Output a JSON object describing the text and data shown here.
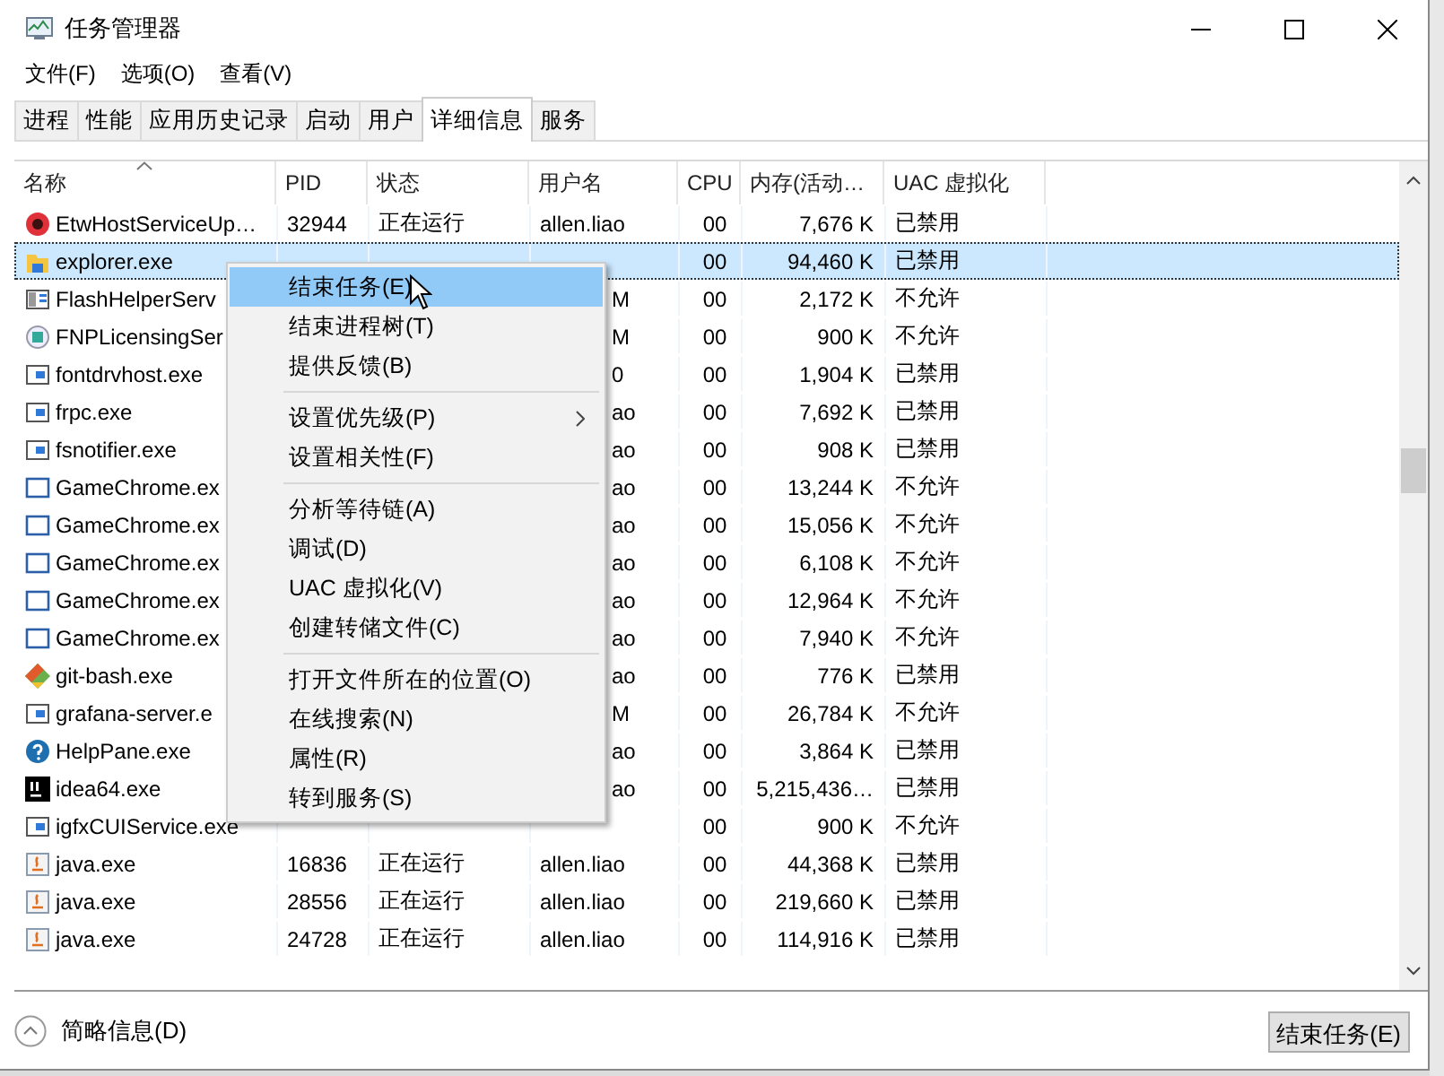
{
  "window": {
    "title": "任务管理器"
  },
  "menu_bar": [
    "文件(F)",
    "选项(O)",
    "查看(V)"
  ],
  "tabs": [
    {
      "label": "进程",
      "selected": false
    },
    {
      "label": "性能",
      "selected": false
    },
    {
      "label": "应用历史记录",
      "selected": false
    },
    {
      "label": "启动",
      "selected": false
    },
    {
      "label": "用户",
      "selected": false
    },
    {
      "label": "详细信息",
      "selected": true
    },
    {
      "label": "服务",
      "selected": false
    }
  ],
  "table": {
    "columns": [
      "名称",
      "PID",
      "状态",
      "用户名",
      "CPU",
      "内存(活动…",
      "UAC 虚拟化"
    ],
    "rows": [
      {
        "name": "EtwHostServiceUp…",
        "pid": "32944",
        "status": "正在运行",
        "user": "allen.liao",
        "cpu": "00",
        "memory": "7,676 K",
        "uac": "已禁用",
        "selected": false
      },
      {
        "name": "explorer.exe",
        "cpu": "00",
        "memory": "94,460 K",
        "uac": "已禁用",
        "selected": true
      },
      {
        "name": "FlashHelperServ",
        "user": "M",
        "cpu": "00",
        "memory": "2,172 K",
        "uac": "不允许",
        "selected": false
      },
      {
        "name": "FNPLicensingSer",
        "user": "M",
        "cpu": "00",
        "memory": "900 K",
        "uac": "不允许",
        "selected": false
      },
      {
        "name": "fontdrvhost.exe",
        "user": "0",
        "cpu": "00",
        "memory": "1,904 K",
        "uac": "已禁用",
        "selected": false
      },
      {
        "name": "frpc.exe",
        "user": "ao",
        "cpu": "00",
        "memory": "7,692 K",
        "uac": "已禁用",
        "selected": false
      },
      {
        "name": "fsnotifier.exe",
        "user": "ao",
        "cpu": "00",
        "memory": "908 K",
        "uac": "已禁用",
        "selected": false
      },
      {
        "name": "GameChrome.ex",
        "user": "ao",
        "cpu": "00",
        "memory": "13,244 K",
        "uac": "不允许",
        "selected": false
      },
      {
        "name": "GameChrome.ex",
        "user": "ao",
        "cpu": "00",
        "memory": "15,056 K",
        "uac": "不允许",
        "selected": false
      },
      {
        "name": "GameChrome.ex",
        "user": "ao",
        "cpu": "00",
        "memory": "6,108 K",
        "uac": "不允许",
        "selected": false
      },
      {
        "name": "GameChrome.ex",
        "user": "ao",
        "cpu": "00",
        "memory": "12,964 K",
        "uac": "不允许",
        "selected": false
      },
      {
        "name": "GameChrome.ex",
        "user": "ao",
        "cpu": "00",
        "memory": "7,940 K",
        "uac": "不允许",
        "selected": false
      },
      {
        "name": "git-bash.exe",
        "user": "ao",
        "cpu": "00",
        "memory": "776 K",
        "uac": "已禁用",
        "selected": false
      },
      {
        "name": "grafana-server.e",
        "user": "M",
        "cpu": "00",
        "memory": "26,784 K",
        "uac": "不允许",
        "selected": false
      },
      {
        "name": "HelpPane.exe",
        "user": "ao",
        "cpu": "00",
        "memory": "3,864 K",
        "uac": "已禁用",
        "selected": false
      },
      {
        "name": "idea64.exe",
        "user": "ao",
        "cpu": "00",
        "memory": "5,215,436…",
        "uac": "已禁用",
        "selected": false
      },
      {
        "name": "igfxCUIService.exe",
        "cpu": "00",
        "memory": "900 K",
        "uac": "不允许",
        "selected": false
      },
      {
        "name": "java.exe",
        "pid": "16836",
        "status": "正在运行",
        "user": "allen.liao",
        "cpu": "00",
        "memory": "44,368 K",
        "uac": "已禁用",
        "selected": false
      },
      {
        "name": "java.exe",
        "pid": "28556",
        "status": "正在运行",
        "user": "allen.liao",
        "cpu": "00",
        "memory": "219,660 K",
        "uac": "已禁用",
        "selected": false
      },
      {
        "name": "java.exe",
        "pid": "24728",
        "status": "正在运行",
        "user": "allen.liao",
        "cpu": "00",
        "memory": "114,916 K",
        "uac": "已禁用",
        "selected": false
      }
    ]
  },
  "context_menu": [
    {
      "label": "结束任务(E)",
      "selected": true
    },
    {
      "label": "结束进程树(T)",
      "selected": false
    },
    {
      "label": "提供反馈(B)",
      "selected": false,
      "separator_after": true
    },
    {
      "label": "设置优先级(P)",
      "selected": false,
      "submenu": true
    },
    {
      "label": "设置相关性(F)",
      "selected": false,
      "separator_after": true
    },
    {
      "label": "分析等待链(A)",
      "selected": false
    },
    {
      "label": "调试(D)",
      "selected": false
    },
    {
      "label": "UAC 虚拟化(V)",
      "selected": false
    },
    {
      "label": "创建转储文件(C)",
      "selected": false,
      "separator_after": true
    },
    {
      "label": "打开文件所在的位置(O)",
      "selected": false
    },
    {
      "label": "在线搜索(N)",
      "selected": false
    },
    {
      "label": "属性(R)",
      "selected": false
    },
    {
      "label": "转到服务(S)",
      "selected": false
    }
  ],
  "footer": {
    "details_toggle": "简略信息(D)",
    "end_task_button": "结束任务(E)"
  }
}
